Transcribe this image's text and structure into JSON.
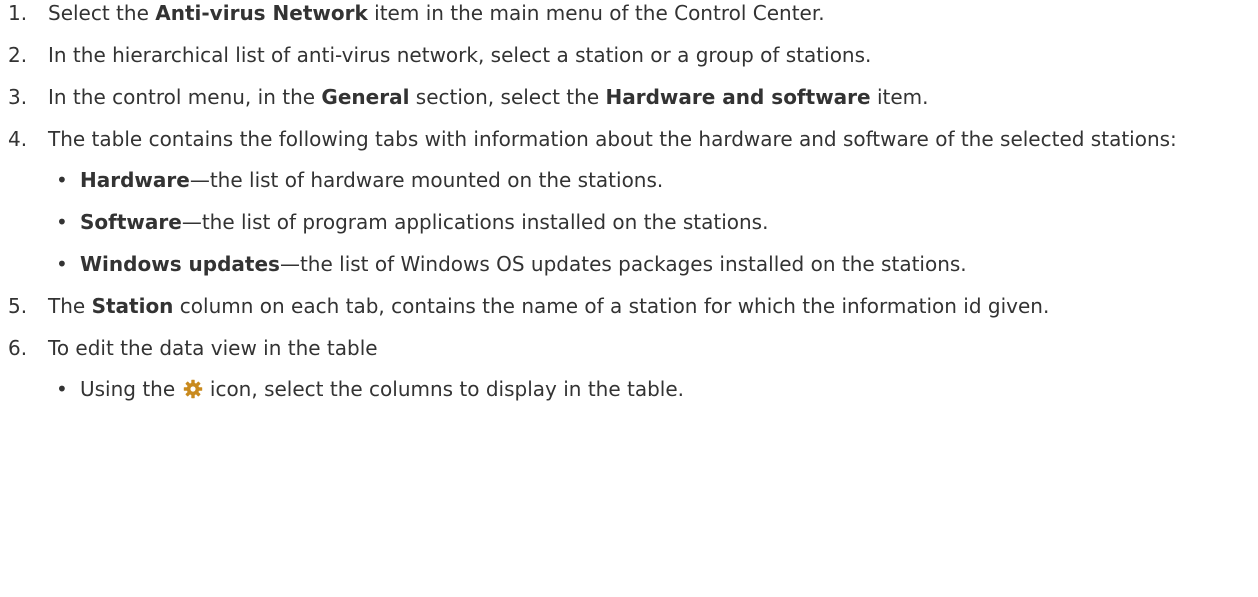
{
  "steps": [
    {
      "num": "1.",
      "parts": [
        "Select the ",
        "Anti-virus Network",
        " item in the main menu of the Control Center."
      ]
    },
    {
      "num": "2.",
      "text": "In the hierarchical list of anti-virus network, select a station or a group of stations."
    },
    {
      "num": "3.",
      "parts": [
        "In the control menu, in the ",
        "General",
        " section, select the ",
        "Hardware and software",
        " item."
      ]
    },
    {
      "num": "4.",
      "text": "The table contains the following tabs with information about the hardware and software of the selected stations:",
      "bullets": [
        {
          "term": "Hardware",
          "desc": "—the list of hardware mounted on the stations."
        },
        {
          "term": "Software",
          "desc": "—the list of program applications installed on the stations."
        },
        {
          "term": "Windows updates",
          "desc": "—the list of Windows OS updates packages installed on the stations."
        }
      ]
    },
    {
      "num": "5.",
      "parts": [
        "The ",
        "Station",
        " column on each tab, contains the name of a station for which the information id given."
      ]
    },
    {
      "num": "6.",
      "text": "To edit the data view in the table",
      "bullets": [
        {
          "pre": "Using the ",
          "icon": "gear-icon",
          "post": " icon, select the columns to display in the table."
        }
      ]
    }
  ],
  "colors": {
    "text": "#333333",
    "gear": "#c98a1e"
  }
}
